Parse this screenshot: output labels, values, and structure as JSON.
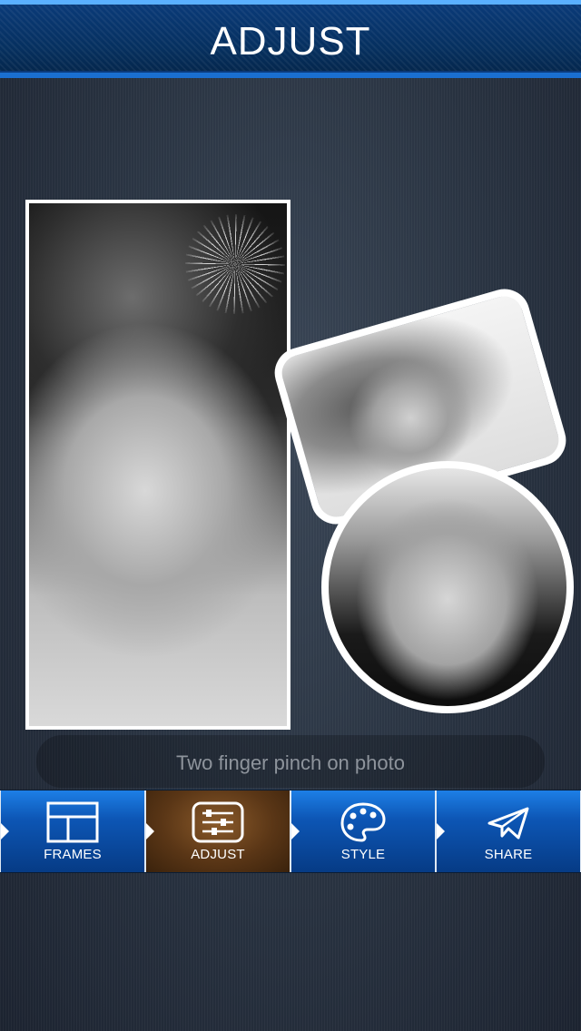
{
  "header": {
    "title": "ADJUST"
  },
  "hint": {
    "text": "Two finger pinch on photo"
  },
  "toolbar": {
    "items": [
      {
        "label": "FRAMES",
        "icon": "frames-icon"
      },
      {
        "label": "ADJUST",
        "icon": "sliders-icon",
        "active": true
      },
      {
        "label": "STYLE",
        "icon": "palette-icon"
      },
      {
        "label": "SHARE",
        "icon": "share-plane-icon"
      }
    ]
  }
}
